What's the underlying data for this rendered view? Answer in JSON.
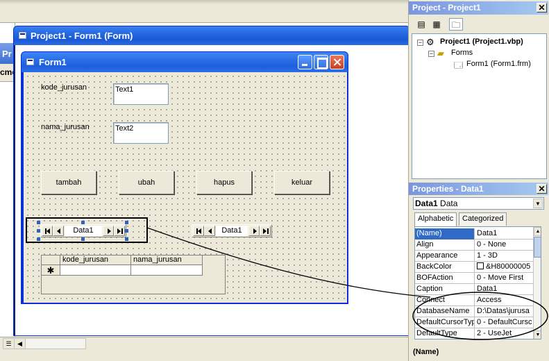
{
  "behind_window": {
    "title_fragment": "Pr",
    "menu_fragment": "cmo"
  },
  "mdi": {
    "title": "Project1 - Form1 (Form)"
  },
  "form": {
    "title": "Form1",
    "labels": {
      "kode": "kode_jurusan",
      "nama": "nama_jurusan"
    },
    "textboxes": {
      "text1": "Text1",
      "text2": "Text2"
    },
    "buttons": {
      "tambah": "tambah",
      "ubah": "ubah",
      "hapus": "hapus",
      "keluar": "keluar"
    },
    "data_controls": [
      {
        "caption": "Data1",
        "selected": true
      },
      {
        "caption": "Data1",
        "selected": false
      }
    ],
    "datagrid": {
      "columns": [
        "kode_jurusan",
        "nama_jurusan"
      ],
      "new_row_marker": "✱"
    }
  },
  "project_explorer": {
    "title": "Project - Project1",
    "tree": [
      {
        "label": "Project1 (Project1.vbp)",
        "level": 0,
        "bold": true,
        "expander": "−"
      },
      {
        "label": "Forms",
        "level": 1,
        "expander": "−"
      },
      {
        "label": "Form1 (Form1.frm)",
        "level": 2
      }
    ]
  },
  "properties": {
    "title": "Properties - Data1",
    "object_name": "Data1",
    "object_type": "Data",
    "tabs": [
      "Alphabetic",
      "Categorized"
    ],
    "active_tab": "Alphabetic",
    "rows": [
      {
        "name": "(Name)",
        "value": "Data1",
        "selected": true
      },
      {
        "name": "Align",
        "value": "0 - None"
      },
      {
        "name": "Appearance",
        "value": "1 - 3D"
      },
      {
        "name": "BackColor",
        "value": "&H80000005"
      },
      {
        "name": "BOFAction",
        "value": "0 - Move First"
      },
      {
        "name": "Caption",
        "value": "Data1"
      },
      {
        "name": "Connect",
        "value": "Access"
      },
      {
        "name": "DatabaseName",
        "value": "D:\\Datas\\jurusa"
      },
      {
        "name": "DefaultCursorType",
        "value": "0 - DefaultCursc"
      },
      {
        "name": "DefaultType",
        "value": "2 - UseJet"
      }
    ],
    "description_title": "(Name)"
  },
  "colors": {
    "xp_blue": "#0831d9",
    "form_bg": "#ece9d8",
    "selection": "#316ac5",
    "annotation": "#000000"
  }
}
